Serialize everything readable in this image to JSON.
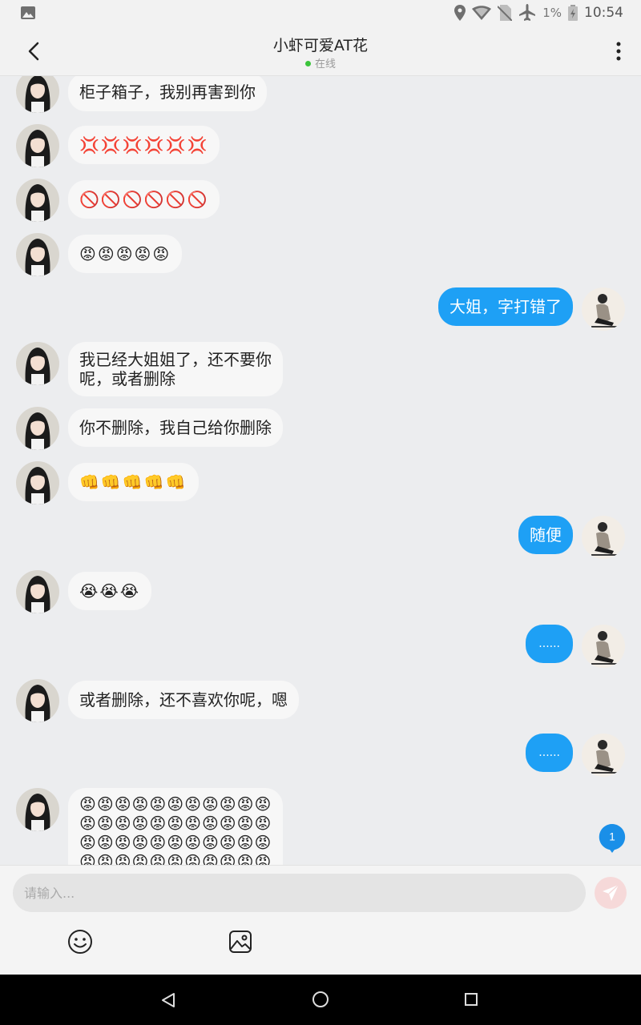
{
  "status_bar": {
    "battery_percent": "1%",
    "time": "10:54"
  },
  "header": {
    "title": "小虾可爱AT花",
    "status": "在线"
  },
  "messages": [
    {
      "side": "in",
      "text": "柜子箱子，我别再害到你"
    },
    {
      "side": "in",
      "text": "💢💢💢💢💢💢"
    },
    {
      "side": "in",
      "text": "🚫🚫🚫🚫🚫🚫"
    },
    {
      "side": "in",
      "text": "😡😡😡😡😡"
    },
    {
      "side": "out",
      "text": "大姐，字打错了"
    },
    {
      "side": "in",
      "text": "我已经大姐姐了，还不要你",
      "text2": "呢，或者删除"
    },
    {
      "side": "in",
      "text": "你不删除，我自己给你删除"
    },
    {
      "side": "in",
      "text": "👊👊👊👊👊"
    },
    {
      "side": "out",
      "text": "随便"
    },
    {
      "side": "in",
      "text": "😭😭😭"
    },
    {
      "side": "out",
      "text": "......"
    },
    {
      "side": "in",
      "text": "或者删除，还不喜欢你呢，嗯"
    },
    {
      "side": "out",
      "text": "......"
    },
    {
      "side": "in",
      "text": "😡😡😡😡😡😡😡😡😡😡😡",
      "text2": "😡😡😡😡😡😡😡😡😡😡😡",
      "text3": "😡😡😡😡😡😡😡😡😡😡😡",
      "text4": "😡😡😡😡😡😡😡😡😡😡😡"
    }
  ],
  "unread_badge": "1",
  "input": {
    "placeholder": "请输入..."
  },
  "icons": {
    "back": "chevron-left-icon",
    "more": "more-vertical-icon",
    "send": "send-icon",
    "emoji": "emoji-icon",
    "image": "image-icon"
  },
  "colors": {
    "outgoing_bubble": "#1ea0f5",
    "incoming_bubble": "#f7f7f7",
    "online": "#3bc43b",
    "badge": "#1a8fe8"
  }
}
